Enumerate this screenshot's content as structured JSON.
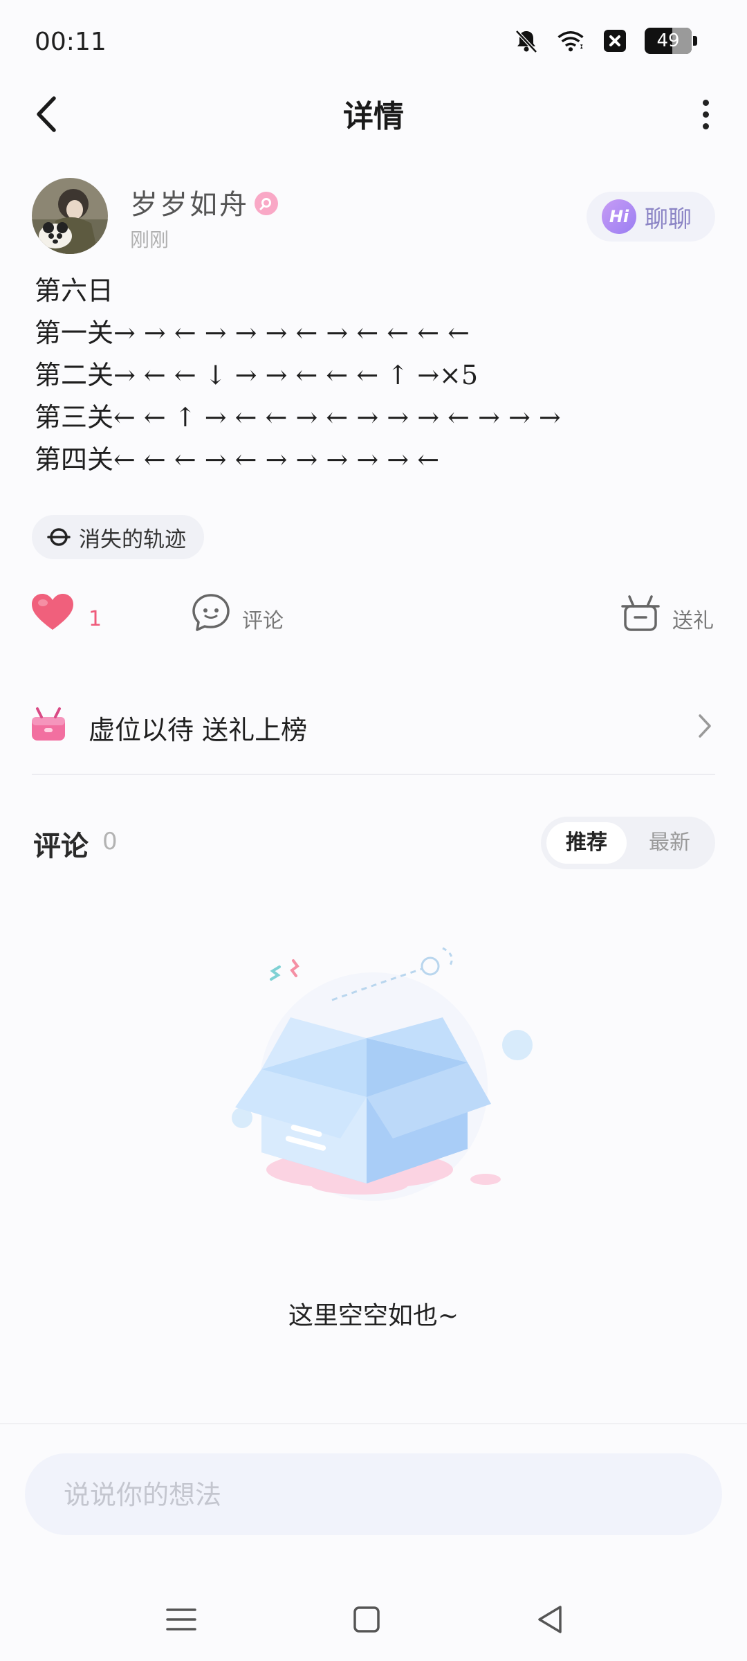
{
  "status_bar": {
    "time": "00:11",
    "battery": "49",
    "icons": [
      "bell-muted-icon",
      "wifi-icon",
      "close-box-icon",
      "battery-icon"
    ]
  },
  "nav": {
    "title": "详情",
    "icons": [
      "back-arrow-icon",
      "more-vertical-icon"
    ]
  },
  "post": {
    "author": "岁岁如舟",
    "time": "刚刚",
    "chat_label": "聊聊",
    "hi_label": "Hi",
    "lines": [
      "第六日",
      "第一关→ → ← → → → ← → ← ← ← ←",
      "第二关→ ← ← ↓ → → ← ← ← ↑ →×5",
      "第三关← ← ↑ → ← ← → ← → → → ← → → →",
      "第四关← ← ← → ← → → → → → ←"
    ],
    "topic": "消失的轨迹"
  },
  "actions": {
    "like_count": "1",
    "comment_label": "评论",
    "gift_label": "送礼",
    "like_color": "#f0607c"
  },
  "gift_rank": {
    "label": "虚位以待 送礼上榜"
  },
  "comments": {
    "title": "评论",
    "count": "0",
    "sort_recommended": "推荐",
    "sort_latest": "最新",
    "empty_text": "这里空空如也~"
  },
  "input": {
    "placeholder": "说说你的想法"
  },
  "system_nav": [
    "menu-icon",
    "home-square-icon",
    "back-triangle-icon"
  ]
}
